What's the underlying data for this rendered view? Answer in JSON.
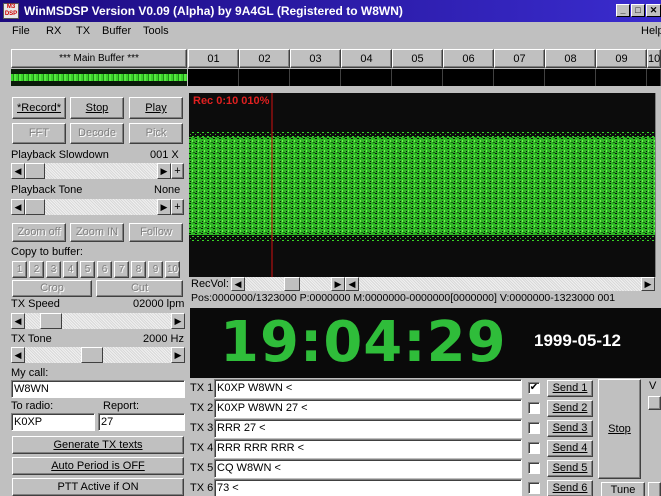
{
  "window": {
    "title": "WinMSDSP Version V0.09 (Alpha) by 9A4GL (Registered to W8WN)",
    "icon_text": "M3 DSP"
  },
  "menu": [
    "File",
    "RX",
    "TX",
    "Buffer",
    "Tools",
    "Help"
  ],
  "buffers": {
    "main": "*** Main Buffer ***",
    "slots": [
      "01",
      "02",
      "03",
      "04",
      "05",
      "06",
      "07",
      "08",
      "09",
      "10"
    ]
  },
  "controls": {
    "record": "*Record*",
    "stop": "Stop",
    "play": "Play",
    "fft": "FFT",
    "decode": "Decode",
    "pick": "Pick",
    "playback_slowdown_label": "Playback Slowdown",
    "playback_slowdown_value": "001 X",
    "playback_tone_label": "Playback Tone",
    "playback_tone_value": "None",
    "zoom_off": "Zoom off",
    "zoom_in": "Zoom IN",
    "follow": "Follow",
    "copy_to_buffer": "Copy to buffer:",
    "copy_slots": [
      "1",
      "2",
      "3",
      "4",
      "5",
      "6",
      "7",
      "8",
      "9",
      "10"
    ],
    "crop": "Crop",
    "cut": "Cut",
    "tx_speed_label": "TX Speed",
    "tx_speed_value": "02000 lpm",
    "tx_tone_label": "TX Tone",
    "tx_tone_value": "2000 Hz",
    "my_call_label": "My call:",
    "my_call_value": "W8WN",
    "to_radio_label": "To radio:",
    "to_radio_value": "K0XP",
    "report_label": "Report:",
    "report_value": "27",
    "generate_tx": "Generate TX texts",
    "auto_period": "Auto Period is OFF",
    "ptt_active": "PTT Active if ON"
  },
  "display": {
    "rec_status": "Rec 0:10 010%",
    "recvol_label": "RecVol:",
    "position": "Pos:0000000/1323000 P:0000000 M:0000000-0000000[0000000] V:0000000-1323000 001",
    "clock": "19:04:29",
    "date": "1999-05-12",
    "signal_color": "#39d42a"
  },
  "tx": [
    {
      "label": "TX 1",
      "text": "K0XP W8WN <",
      "send": "Send 1",
      "checked": true
    },
    {
      "label": "TX 2",
      "text": "K0XP W8WN 27 <",
      "send": "Send 2",
      "checked": false
    },
    {
      "label": "TX 3",
      "text": "RRR 27 <",
      "send": "Send 3",
      "checked": false
    },
    {
      "label": "TX 4",
      "text": "RRR RRR RRR <",
      "send": "Send 4",
      "checked": false
    },
    {
      "label": "TX 5",
      "text": "CQ W8WN <",
      "send": "Send 5",
      "checked": false
    },
    {
      "label": "TX 6",
      "text": "73 <",
      "send": "Send 6",
      "checked": false
    }
  ],
  "tx_actions": {
    "stop": "Stop",
    "tune": "Tune",
    "right_label": "V"
  },
  "progress": {
    "slowdown": 0.0,
    "tone": 0.0,
    "tx_speed": 0.12,
    "tx_tone": 0.45,
    "recvol": 0.55,
    "record_cursor": 0.25
  }
}
